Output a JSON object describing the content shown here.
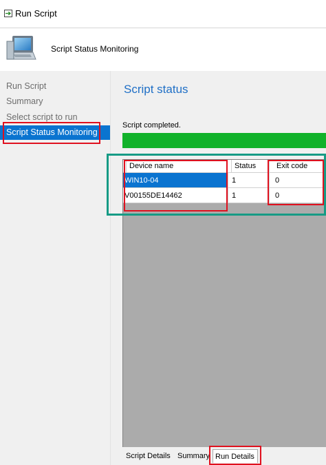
{
  "window": {
    "title": "Run Script"
  },
  "header": {
    "title": "Script Status Monitoring"
  },
  "nav": {
    "items": [
      {
        "label": "Run Script"
      },
      {
        "label": "Summary"
      },
      {
        "label": "Select script to run"
      },
      {
        "label": "Script Status Monitoring",
        "selected": true
      }
    ]
  },
  "main": {
    "section_title": "Script status",
    "status_text": "Script completed.",
    "progress_percent": 100,
    "progress_color": "#11b22a"
  },
  "grid": {
    "columns": [
      "Device name",
      "Status",
      "Exit code"
    ],
    "rows": [
      {
        "device": "WIN10-04",
        "status": "1",
        "exit_code": "0",
        "selected": true
      },
      {
        "device": "V00155DE14462",
        "status": "1",
        "exit_code": "0",
        "selected": false
      }
    ]
  },
  "tabs": [
    "Script Details",
    "Summary",
    "Run Details"
  ],
  "active_tab": "Run Details",
  "annotation_colors": {
    "red": "#e0101e",
    "teal": "#169b85"
  }
}
